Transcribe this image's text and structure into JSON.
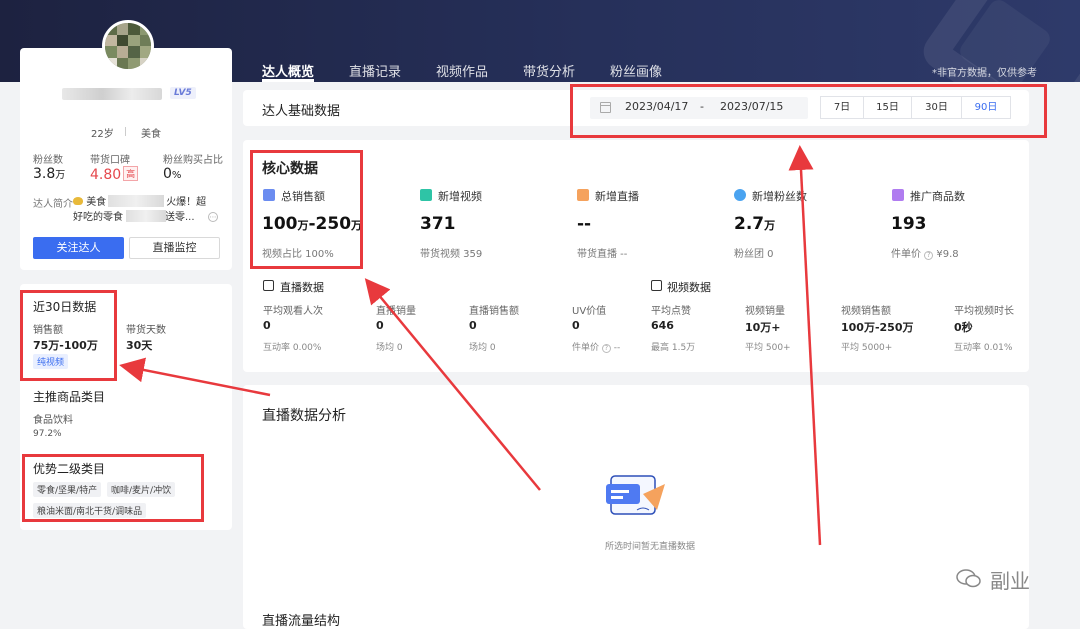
{
  "nav": {
    "tabs": [
      {
        "label": "达人概览",
        "active": true
      },
      {
        "label": "直播记录"
      },
      {
        "label": "视频作品"
      },
      {
        "label": "带货分析"
      },
      {
        "label": "粉丝画像"
      }
    ],
    "note": "*非官方数据，仅供参考"
  },
  "profile": {
    "level": "LV5",
    "age": "22岁",
    "category": "美食",
    "stats": [
      {
        "label": "粉丝数",
        "value": "3.8",
        "unit": "万"
      },
      {
        "label": "带货口碑",
        "value": "4.80",
        "tag": "高"
      },
      {
        "label": "粉丝购买占比",
        "value": "0",
        "unit": "%"
      }
    ],
    "intro_label": "达人简介",
    "intro_line1_a": "美食",
    "intro_line1_b": "火爆！超",
    "intro_line2_a": "好吃的零食",
    "intro_line2_b": "送零...",
    "follow_button": "关注达人",
    "monitor_button": "直播监控"
  },
  "recent": {
    "title": "近30日数据",
    "sales_label": "销售额",
    "sales_value": "75万-100万",
    "days_label": "带货天数",
    "days_value": "30天",
    "tag": "纯视频",
    "main_cat_title": "主推商品类目",
    "main_cat_name": "食品饮料",
    "main_cat_pct": "97.2%",
    "sub_cat_title": "优势二级类目",
    "sub_cats": [
      "零食/坚果/特产",
      "咖啡/麦片/冲饮",
      "粮油米面/南北干货/调味品"
    ]
  },
  "basic": {
    "title": "达人基础数据",
    "date_from": "2023/04/17",
    "date_sep": "-",
    "date_to": "2023/07/15",
    "ranges": [
      {
        "label": "7日"
      },
      {
        "label": "15日"
      },
      {
        "label": "30日"
      },
      {
        "label": "90日",
        "selected": true
      }
    ]
  },
  "core": {
    "title": "核心数据",
    "metrics": [
      {
        "label": "总销售额",
        "value_a": "100",
        "unit_a": "万",
        "value_b": "-250",
        "unit_b": "万",
        "sub": "视频占比 100%",
        "icon": "sales-icon",
        "color": "#6b8cf0"
      },
      {
        "label": "新增视频",
        "value_a": "371",
        "sub": "带货视频 359",
        "icon": "video-icon",
        "color": "#2ec4a6"
      },
      {
        "label": "新增直播",
        "value_a": "--",
        "sub": "带货直播 --",
        "icon": "live-icon",
        "color": "#f5a25d"
      },
      {
        "label": "新增粉丝数",
        "value_a": "2.7",
        "unit_a": "万",
        "sub": "粉丝团 0",
        "icon": "fans-icon",
        "color": "#4aa3f0"
      },
      {
        "label": "推广商品数",
        "value_a": "193",
        "sub": "件单价",
        "sub2": "¥9.8",
        "icon": "goods-icon",
        "color": "#b07cf0"
      }
    ],
    "live_section": "直播数据",
    "video_section": "视频数据",
    "live_cells": [
      {
        "label": "平均观看人次",
        "value": "0",
        "sub": "互动率 0.00%"
      },
      {
        "label": "直播销量",
        "value": "0",
        "sub": "场均 0"
      },
      {
        "label": "直播销售额",
        "value": "0",
        "sub": "场均 0"
      },
      {
        "label": "UV价值",
        "value": "0",
        "sub": "件单价",
        "sub2": "--"
      }
    ],
    "video_cells": [
      {
        "label": "平均点赞",
        "value": "646",
        "sub": "最高 1.5万"
      },
      {
        "label": "视频销量",
        "value": "10万+",
        "sub": "平均 500+"
      },
      {
        "label": "视频销售额",
        "value": "100万-250万",
        "sub": "平均 5000+"
      },
      {
        "label": "平均视频时长",
        "value": "0秒",
        "sub": "互动率 0.01%"
      }
    ]
  },
  "live_analysis": {
    "title": "直播数据分析",
    "empty_text": "所选时间暂无直播数据",
    "flow_title": "直播流量结构"
  },
  "watermark": "副业"
}
